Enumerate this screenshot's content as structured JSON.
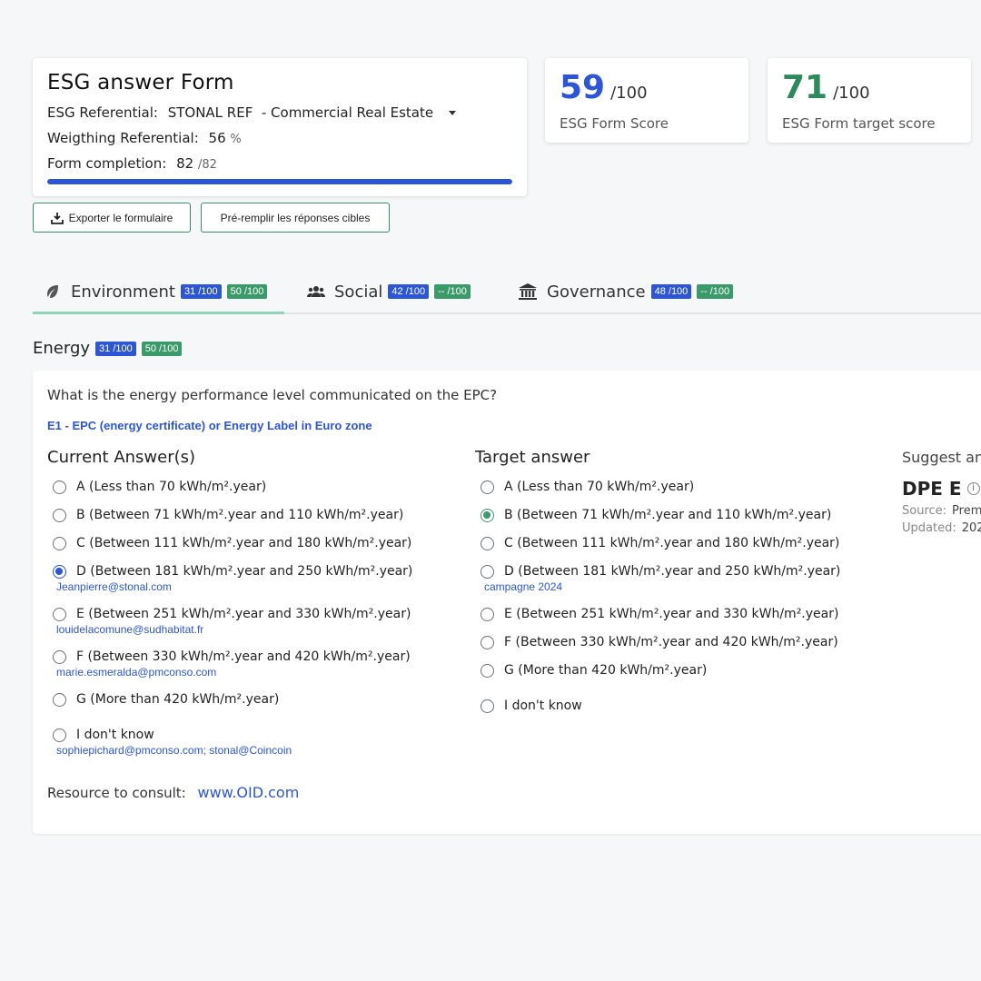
{
  "form": {
    "title": "ESG answer Form",
    "referential_label": "ESG Referential:",
    "referential_value": "STONAL REF  - Commercial Real Estate",
    "weighting_label": "Weigthing Referential:",
    "weighting_value": "56",
    "weighting_unit": "%",
    "completion_label": "Form completion:",
    "completion_value": "82",
    "completion_total": "/82",
    "completion_ratio": 1.0
  },
  "scores": {
    "form_score": "59",
    "form_score_of": "/100",
    "form_score_label": "ESG Form Score",
    "target_score": "71",
    "target_score_of": "/100",
    "target_score_label": "ESG Form target score"
  },
  "actions": {
    "export_label": "Exporter le formulaire",
    "prefill_label": "Pré-remplir les réponses cibles"
  },
  "tabs": [
    {
      "label": "Environment",
      "score": "31 /100",
      "target": "50 /100"
    },
    {
      "label": "Social",
      "score": "42 /100",
      "target": "-- /100"
    },
    {
      "label": "Governance",
      "score": "48 /100",
      "target": "-- /100"
    }
  ],
  "section": {
    "title": "Energy",
    "score": "31 /100",
    "target": "50 /100"
  },
  "question": {
    "text": "What is the energy performance level communicated on the EPC?",
    "reference": "E1 - EPC (energy certificate) or Energy Label in Euro zone",
    "current_title": "Current Answer(s)",
    "target_title": "Target answer",
    "suggest_title": "Suggest an",
    "current_options": [
      {
        "label": "A (Less than 70 kWh/m².year)",
        "sub": ""
      },
      {
        "label": "B (Between 71 kWh/m².year and 110 kWh/m².year)",
        "sub": ""
      },
      {
        "label": "C (Between 111 kWh/m².year and 180 kWh/m².year)",
        "sub": ""
      },
      {
        "label": "D (Between 181 kWh/m².year and 250 kWh/m².year)",
        "sub": "Jeanpierre@stonal.com"
      },
      {
        "label": "E (Between 251 kWh/m².year and 330 kWh/m².year)",
        "sub": "louidelacomune@sudhabitat.fr"
      },
      {
        "label": "F (Between 330 kWh/m².year and 420 kWh/m².year)",
        "sub": "marie.esmeralda@pmconso.com"
      },
      {
        "label": "G (More than 420 kWh/m².year)",
        "sub": ""
      },
      {
        "label": "I don't know",
        "sub": "sophiepichard@pmconso.com; stonal@Coincoin"
      }
    ],
    "target_options": [
      {
        "label": "A (Less than 70 kWh/m².year)",
        "sub": ""
      },
      {
        "label": "B (Between 71 kWh/m².year and 110 kWh/m².year)",
        "sub": ""
      },
      {
        "label": "C (Between 111 kWh/m².year and 180 kWh/m².year)",
        "sub": ""
      },
      {
        "label": "D (Between 181 kWh/m².year and 250 kWh/m².year)",
        "sub": "campagne 2024"
      },
      {
        "label": "E (Between 251 kWh/m².year and 330 kWh/m².year)",
        "sub": ""
      },
      {
        "label": "F (Between 330 kWh/m².year and 420 kWh/m².year)",
        "sub": ""
      },
      {
        "label": "G (More than 420 kWh/m².year)",
        "sub": ""
      },
      {
        "label": "I don't know",
        "sub": ""
      }
    ],
    "current_selected": "D",
    "target_selected": "B",
    "resource_label": "Resource to consult:",
    "resource_link": "www.OID.com",
    "suggestion_value": "DPE E",
    "suggestion_source_label": "Source:",
    "suggestion_source_value": "Prem",
    "suggestion_updated_label": "Updated:",
    "suggestion_updated_value": "202"
  },
  "colors": {
    "accent_blue": "#2c56d6",
    "accent_green": "#3a9a6a",
    "tab_underline": "#8fd4b6"
  }
}
